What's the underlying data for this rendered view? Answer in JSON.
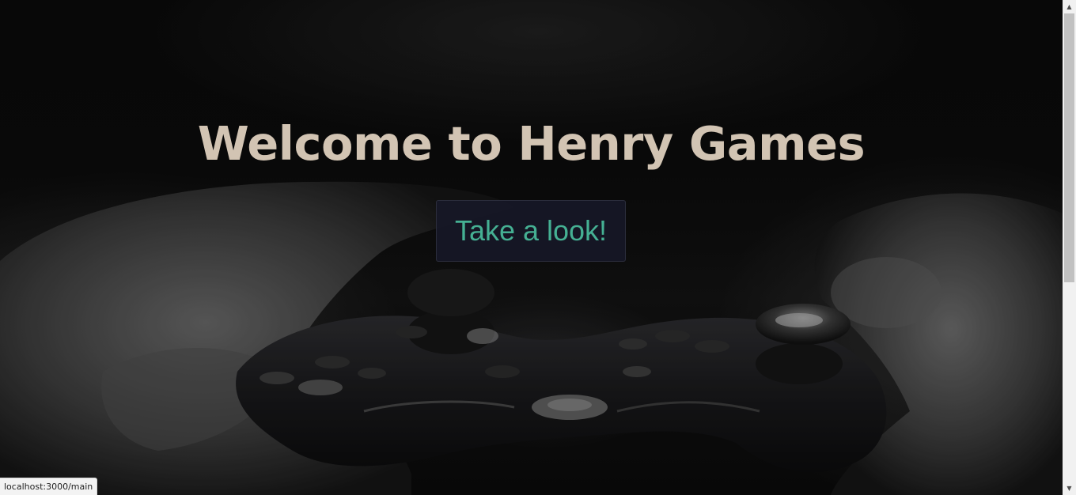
{
  "hero": {
    "title": "Welcome to Henry Games",
    "button_label": "Take a look!",
    "background_image": "hands-holding-game-controller"
  },
  "status_bar": {
    "url": "localhost:3000/main"
  },
  "scrollbar": {
    "up_arrow": "▲",
    "down_arrow": "▼"
  },
  "colors": {
    "title": "#d2c4b3",
    "button_text": "#45b093",
    "button_background": "#171828",
    "page_background": "#050505"
  }
}
